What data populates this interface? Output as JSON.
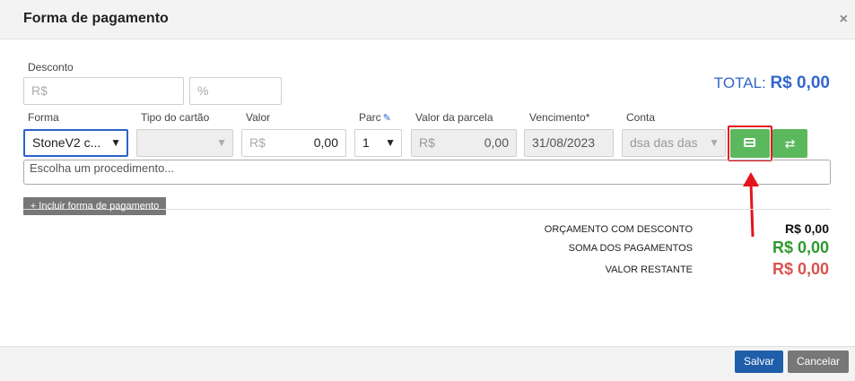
{
  "header": {
    "title": "Forma de pagamento",
    "close": "×"
  },
  "discount": {
    "label": "Desconto",
    "currency_placeholder": "R$",
    "percent_placeholder": "%"
  },
  "total": {
    "label": "TOTAL:",
    "value": "R$ 0,00"
  },
  "columns": {
    "forma": "Forma",
    "tipo_cartao": "Tipo do cartão",
    "valor": "Valor",
    "parc": "Parc",
    "valor_parcela": "Valor da parcela",
    "vencimento": "Vencimento*",
    "conta": "Conta"
  },
  "row": {
    "forma_value": "StoneV2 c...",
    "tipo_cartao_value": "",
    "valor_prefix": "R$",
    "valor_value": "0,00",
    "parc_value": "1",
    "valor_parcela_prefix": "R$",
    "valor_parcela_value": "0,00",
    "vencimento_value": "31/08/2023",
    "conta_value": "dsa das das"
  },
  "procedure": {
    "placeholder": "Escolha um procedimento..."
  },
  "include_button": "+ Incluir forma de pagamento",
  "summary": {
    "orcamento_label": "ORÇAMENTO COM DESCONTO",
    "orcamento_value": "R$ 0,00",
    "soma_label": "SOMA DOS PAGAMENTOS",
    "soma_value": "R$ 0,00",
    "restante_label": "VALOR RESTANTE",
    "restante_value": "R$ 0,00"
  },
  "footer": {
    "save": "Salvar",
    "cancel": "Cancelar"
  },
  "colors": {
    "total_blue": "#3366cc",
    "green": "#5cb85c",
    "sum_green": "#2e9a2e",
    "remaining_red": "#d9534f",
    "highlight_red": "#e3141d"
  },
  "icons": {
    "card": "credit-card-icon",
    "swap": "exchange-icon",
    "edit": "edit-icon",
    "close": "close-icon"
  }
}
